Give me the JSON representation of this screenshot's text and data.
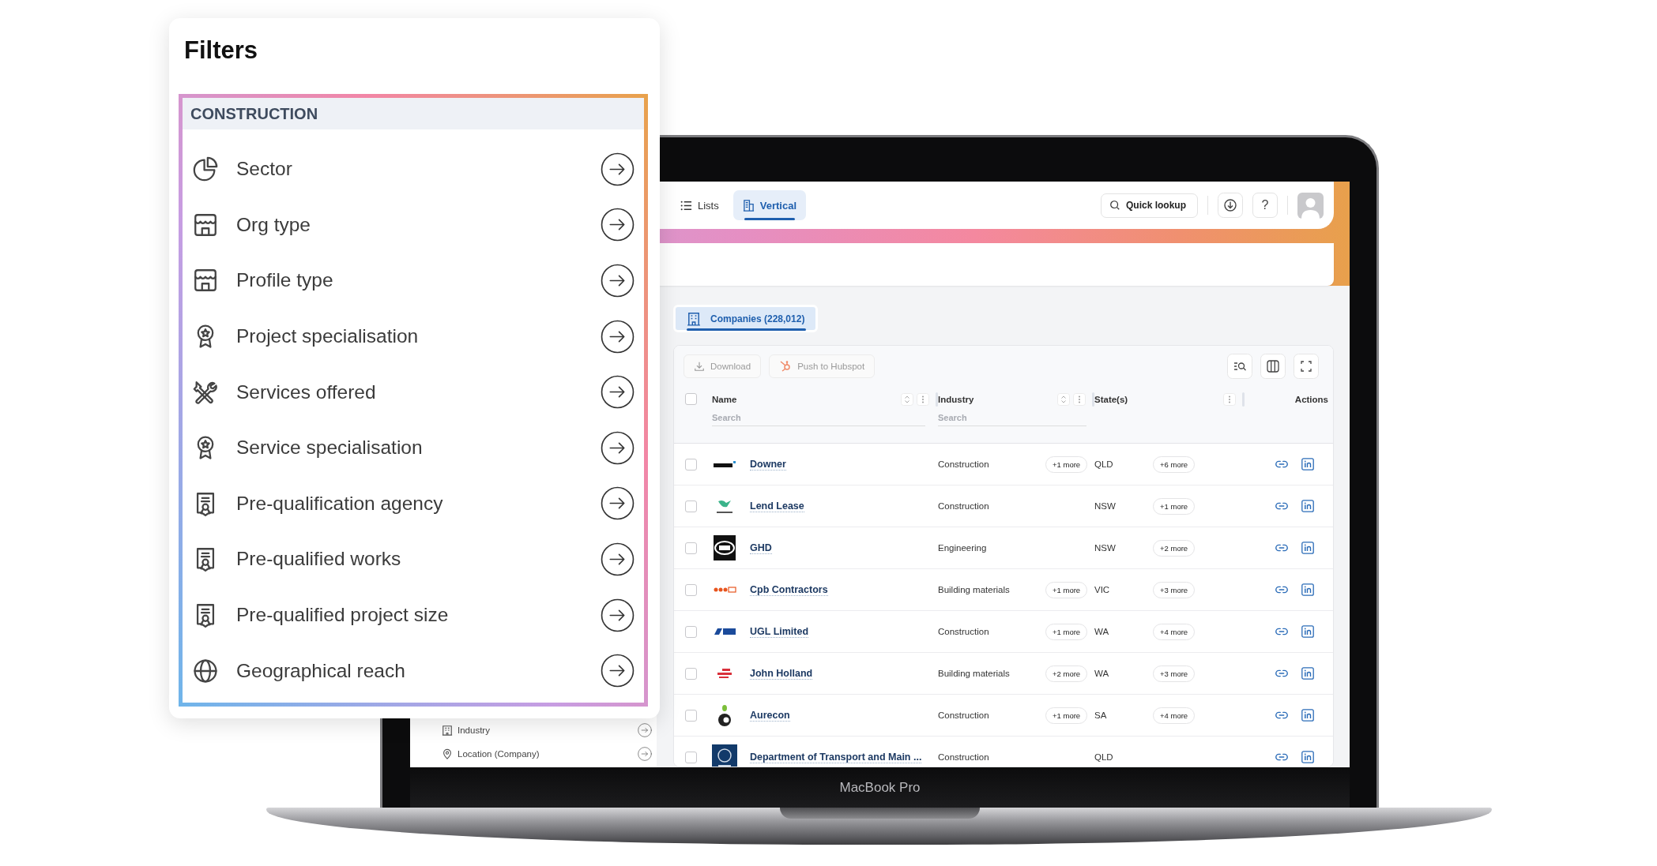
{
  "filters": {
    "title": "Filters",
    "section": "CONSTRUCTION",
    "items": [
      {
        "label": "Sector"
      },
      {
        "label": "Org type"
      },
      {
        "label": "Profile type"
      },
      {
        "label": "Project specialisation"
      },
      {
        "label": "Services offered"
      },
      {
        "label": "Service specialisation"
      },
      {
        "label": "Pre-qualification agency"
      },
      {
        "label": "Pre-qualified works"
      },
      {
        "label": "Pre-qualified project size"
      },
      {
        "label": "Geographical reach"
      }
    ]
  },
  "laptop": {
    "label": "MacBook Pro"
  },
  "app": {
    "nav_tabs": [
      {
        "label": "Lists",
        "selected": false
      },
      {
        "label": "Vertical",
        "selected": true
      }
    ],
    "quick_lookup": "Quick lookup",
    "help": "?",
    "sidebar_items": [
      {
        "label": "Industry"
      },
      {
        "label": "Location (Company)"
      }
    ],
    "entity_tabs": [
      {
        "label": "Companies (228,012)",
        "selected": true
      }
    ],
    "toolbar": [
      {
        "label": "Download",
        "disabled": true
      },
      {
        "label": "Push to Hubspot",
        "disabled": true
      }
    ],
    "table": {
      "select_all_checked": false,
      "columns": [
        {
          "label": "Name",
          "placeholder": "Search"
        },
        {
          "label": "Industry",
          "placeholder": "Search"
        },
        {
          "label": "State(s)"
        },
        {
          "label": "Actions"
        }
      ],
      "rows": [
        {
          "checked": false,
          "name": "Downer",
          "industry": "Construction",
          "industry_more": "+1 more",
          "state": "QLD",
          "state_more": "+6 more"
        },
        {
          "checked": false,
          "name": "Lend Lease",
          "industry": "Construction",
          "state": "NSW",
          "state_more": "+1 more"
        },
        {
          "checked": false,
          "name": "GHD",
          "industry": "Engineering",
          "state": "NSW",
          "state_more": "+2 more"
        },
        {
          "checked": false,
          "name": "Cpb Contractors",
          "industry": "Building materials",
          "industry_more": "+1 more",
          "state": "VIC",
          "state_more": "+3 more"
        },
        {
          "checked": false,
          "name": "UGL Limited",
          "industry": "Construction",
          "industry_more": "+1 more",
          "state": "WA",
          "state_more": "+4 more"
        },
        {
          "checked": false,
          "name": "John Holland",
          "industry": "Building materials",
          "industry_more": "+2 more",
          "state": "WA",
          "state_more": "+3 more"
        },
        {
          "checked": false,
          "name": "Aurecon",
          "industry": "Construction",
          "industry_more": "+1 more",
          "state": "SA",
          "state_more": "+4 more"
        },
        {
          "checked": false,
          "name": "Department of Transport and Main ...",
          "industry": "Construction",
          "state": "QLD"
        }
      ]
    }
  }
}
